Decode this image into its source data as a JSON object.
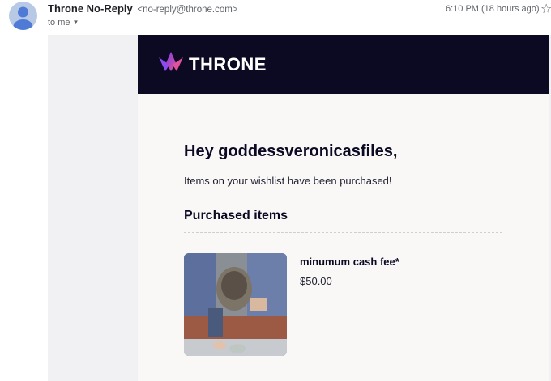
{
  "header": {
    "sender_name": "Throne No-Reply",
    "sender_email": "<no-reply@throne.com>",
    "recipient": "to me",
    "timestamp": "6:10 PM (18 hours ago)",
    "caret_glyph": "▼",
    "star_glyph": "☆"
  },
  "email": {
    "logo_text": "THRONE",
    "greeting": "Hey goddessveronicasfiles,",
    "message": "Items on your wishlist have been purchased!",
    "section_title": "Purchased items",
    "items": [
      {
        "name": "minumum cash fee*",
        "price": "$50.00"
      }
    ]
  },
  "colors": {
    "banner_bg": "#0b0a22",
    "page_bg": "#f1f1f4",
    "card_bg": "#f9f8f7",
    "accent_purple": "#7b3fe4",
    "accent_pink": "#e0529c"
  }
}
